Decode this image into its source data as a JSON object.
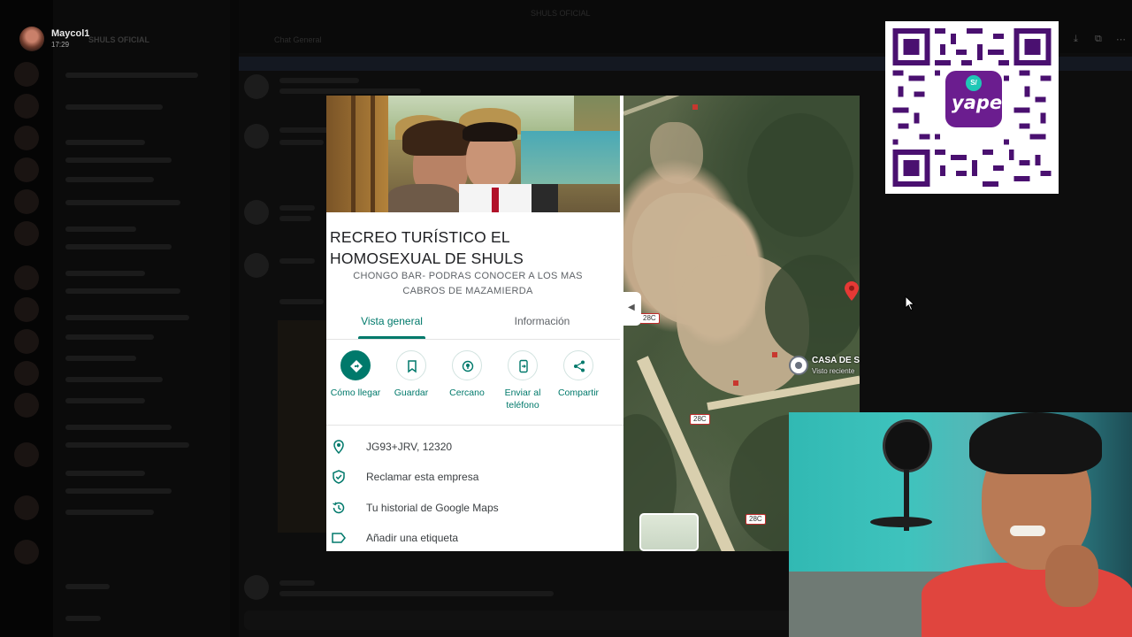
{
  "discord": {
    "user_name": "Maycol1",
    "user_time": "17:29",
    "server_name": "SHULS OFICIAL",
    "window_title": "SHULS OFICIAL",
    "channel_name": "Chat General"
  },
  "maps": {
    "place_title": "RECREO TURÍSTICO EL HOMOSEXUAL DE SHULS",
    "subtitle": "CHONGO BAR- PODRAS CONOCER A LOS MAS CABROS DE MAZAMIERDA",
    "tabs": [
      {
        "label": "Vista general",
        "active": true
      },
      {
        "label": "Información",
        "active": false
      }
    ],
    "actions": [
      {
        "label": "Cómo llegar",
        "icon": "directions-icon"
      },
      {
        "label": "Guardar",
        "icon": "bookmark-icon"
      },
      {
        "label": "Cercano",
        "icon": "nearby-icon"
      },
      {
        "label": "Enviar al teléfono",
        "icon": "send-to-phone-icon"
      },
      {
        "label": "Compartir",
        "icon": "share-icon"
      }
    ],
    "info": [
      {
        "text": "JG93+JRV, 12320",
        "icon": "location-pin-icon"
      },
      {
        "text": "Reclamar esta empresa",
        "icon": "shield-check-icon"
      },
      {
        "text": "Tu historial de Google Maps",
        "icon": "history-icon"
      },
      {
        "text": "Añadir una etiqueta",
        "icon": "label-icon"
      }
    ],
    "accent_color": "#00796b"
  },
  "satellite": {
    "road_labels": [
      "28C",
      "28C",
      "28C"
    ],
    "poi_label": "CASA DE S",
    "poi_sublabel": "Visto reciente"
  },
  "qr": {
    "brand": "yape",
    "coin_symbol": "S/",
    "brand_color": "#6b1d8f"
  }
}
